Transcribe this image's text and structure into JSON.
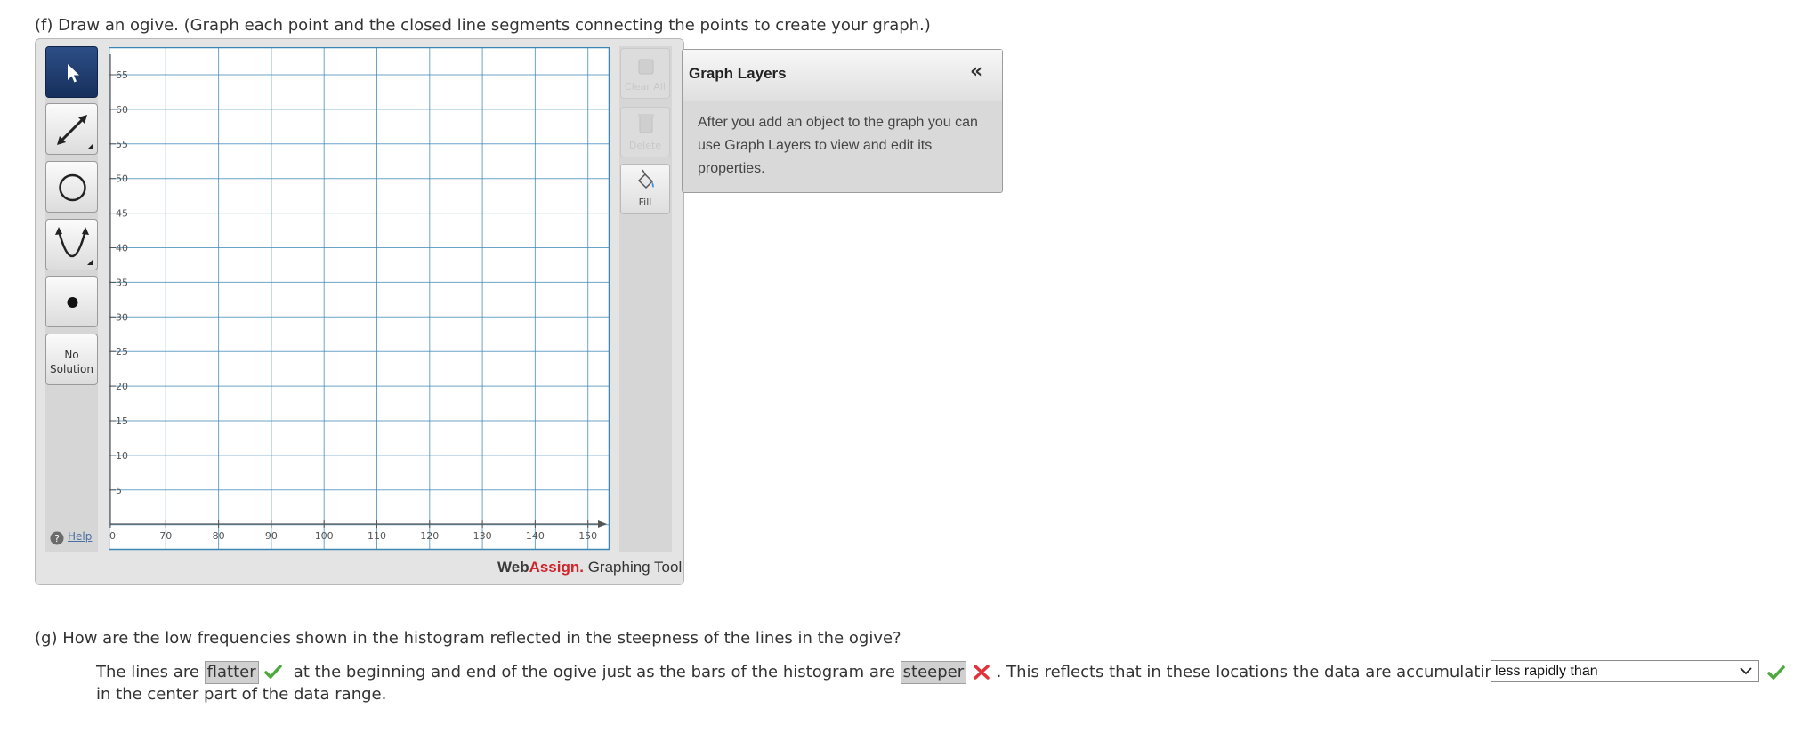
{
  "part_f": {
    "prompt": "(f) Draw an ogive. (Graph each point and the closed line segments connecting the points to create your graph.)"
  },
  "toolbar": {
    "tools": [
      {
        "name": "select-tool",
        "icon": "arrow-pointer-icon",
        "active": true
      },
      {
        "name": "line-segment-tool",
        "icon": "line-segment-icon"
      },
      {
        "name": "circle-tool",
        "icon": "circle-icon"
      },
      {
        "name": "parabola-tool",
        "icon": "parabola-icon"
      },
      {
        "name": "point-tool",
        "icon": "point-icon"
      }
    ],
    "no_solution_line1": "No",
    "no_solution_line2": "Solution",
    "help_label": "Help"
  },
  "side_buttons": {
    "clear_all": "Clear All",
    "delete": "Delete",
    "fill": "Fill"
  },
  "graph": {
    "x_ticks": [
      "0",
      "70",
      "80",
      "90",
      "100",
      "110",
      "120",
      "130",
      "140",
      "150"
    ],
    "y_ticks": [
      "65",
      "60",
      "55",
      "50",
      "45",
      "40",
      "35",
      "30",
      "25",
      "20",
      "15",
      "10",
      "5"
    ],
    "grid_color": "#3a86b5"
  },
  "branding": {
    "web": "Web",
    "assign": "Assign.",
    "rest": " Graphing Tool"
  },
  "graph_layers": {
    "title": "Graph Layers",
    "collapse_glyph": "«",
    "body": "After you add an object to the graph you can use Graph Layers to view and edit its properties."
  },
  "part_g": {
    "prompt": "(g) How are the low frequencies shown in the histogram reflected in the steepness of the lines in the ogive?",
    "text1": "The lines are",
    "blank1": "flatter",
    "blank1_status": "correct",
    "text2": "at the beginning and end of the ogive just as the bars of the histogram are",
    "blank2": "steeper",
    "blank2_status": "incorrect",
    "text3": ". This reflects that in these locations the data are accumulating",
    "select_value": "less rapidly than",
    "select_status": "correct",
    "text4": "in the center part of the data range."
  },
  "colors": {
    "correct": "#4caa3c",
    "incorrect": "#e0343a",
    "brand_red": "#d0242b"
  }
}
